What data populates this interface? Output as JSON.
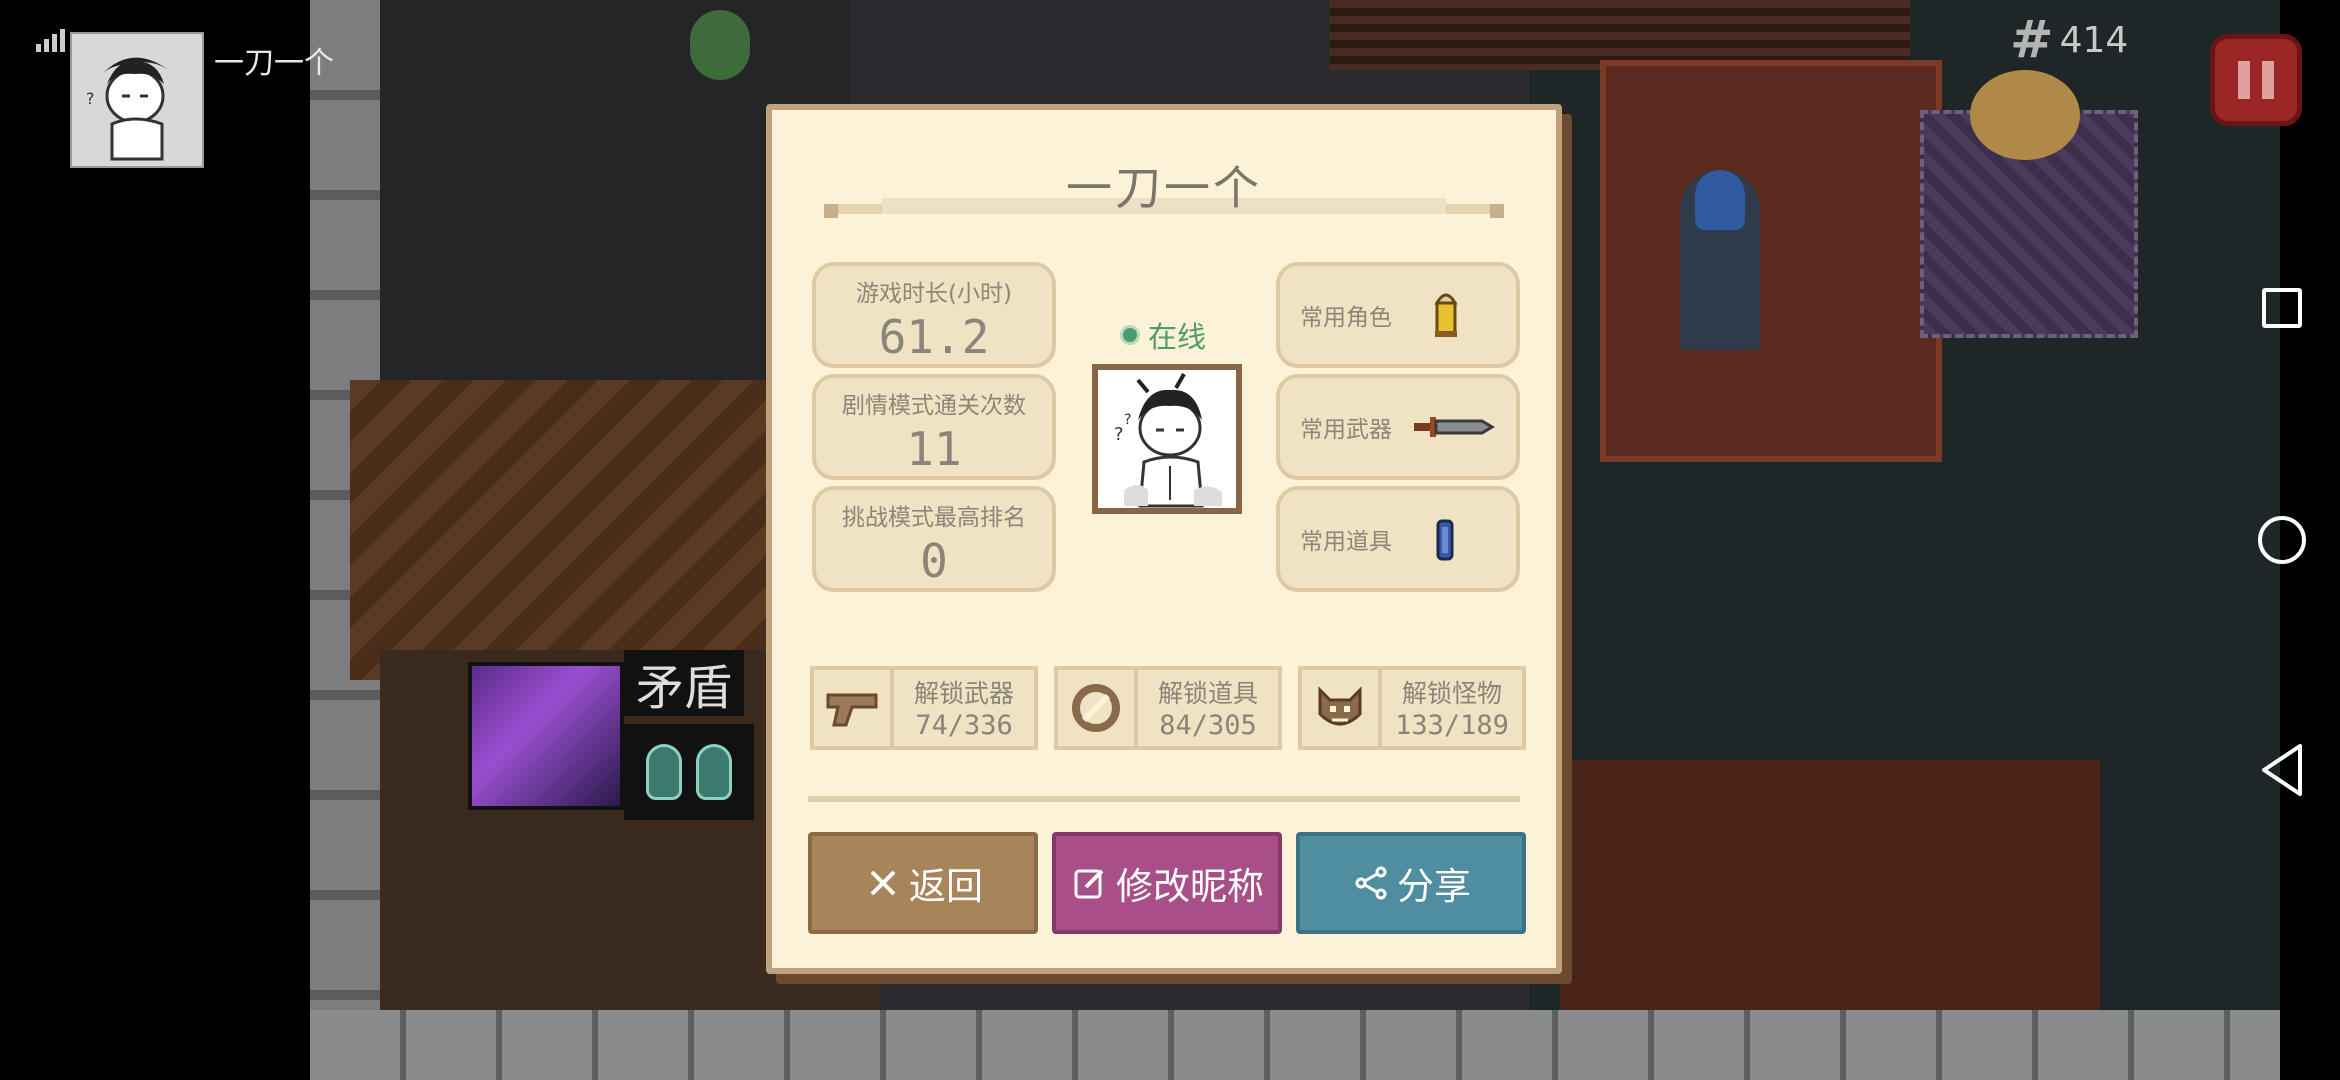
{
  "player": {
    "name": "一刀一个"
  },
  "hud": {
    "gem_count": "414",
    "skill_label": "矛盾"
  },
  "dialog": {
    "title": "一刀一个",
    "online_status": "在线",
    "stats": [
      {
        "label": "游戏时长(小时)",
        "value": "61.2"
      },
      {
        "label": "剧情模式通关次数",
        "value": "11"
      },
      {
        "label": "挑战模式最高排名",
        "value": "0"
      }
    ],
    "favorites": [
      {
        "label": "常用角色",
        "icon": "bullet-character-icon"
      },
      {
        "label": "常用武器",
        "icon": "sword-icon"
      },
      {
        "label": "常用道具",
        "icon": "blue-item-icon"
      }
    ],
    "unlocks": [
      {
        "label": "解锁武器",
        "count": "74/336",
        "icon": "pistol-icon"
      },
      {
        "label": "解锁道具",
        "count": "84/305",
        "icon": "item-ring-icon"
      },
      {
        "label": "解锁怪物",
        "count": "133/189",
        "icon": "monster-icon"
      }
    ],
    "buttons": {
      "back": "返回",
      "rename": "修改昵称",
      "share": "分享"
    }
  },
  "colors": {
    "dialog_bg": "#fbf2d8",
    "back_button": "#a8845b",
    "rename_button": "#a74f86",
    "share_button": "#4f8ea0",
    "online_green": "#4e9c6a",
    "pause_red": "#9a2626"
  }
}
